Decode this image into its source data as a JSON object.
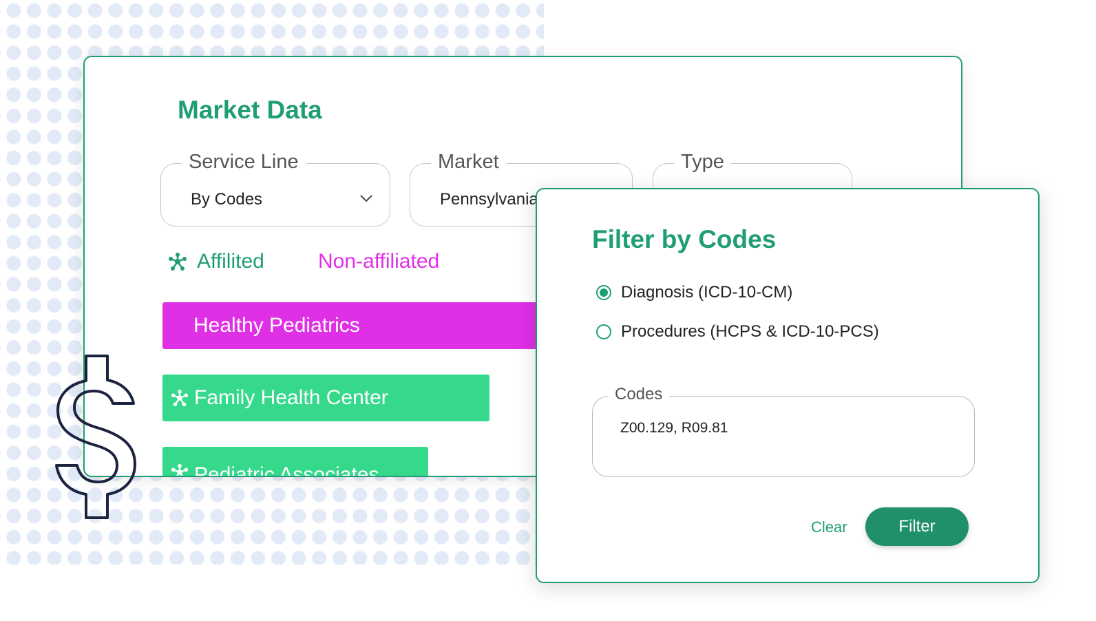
{
  "colors": {
    "brand_green": "#1f9e74",
    "magenta": "#e030e6",
    "bar_green": "#36d98b",
    "button_green": "#1f8f6c"
  },
  "market_data": {
    "title": "Market Data",
    "service_line": {
      "label": "Service Line",
      "value": "By Codes"
    },
    "market": {
      "label": "Market",
      "value": "Pennsylvania"
    },
    "type": {
      "label": "Type",
      "value": ""
    },
    "legend": {
      "affiliated": "Affilited",
      "non_affiliated": "Non-affiliated"
    },
    "bars": [
      {
        "label": "Healthy Pediatrics",
        "affiliated": false
      },
      {
        "label": "Family Health Center",
        "affiliated": true
      },
      {
        "label": "Pediatric Associates",
        "affiliated": true
      }
    ]
  },
  "filter_modal": {
    "title": "Filter by Codes",
    "options": [
      {
        "label": "Diagnosis (ICD-10-CM)",
        "selected": true
      },
      {
        "label": "Procedures (HCPS & ICD-10-PCS)",
        "selected": false
      }
    ],
    "codes": {
      "label": "Codes",
      "value": "Z00.129, R09.81"
    },
    "clear_label": "Clear",
    "filter_label": "Filter"
  },
  "icons": {
    "affiliated": "network-node-icon",
    "dropdown": "chevron-down-icon",
    "decoration": "dollar-sign-icon"
  }
}
